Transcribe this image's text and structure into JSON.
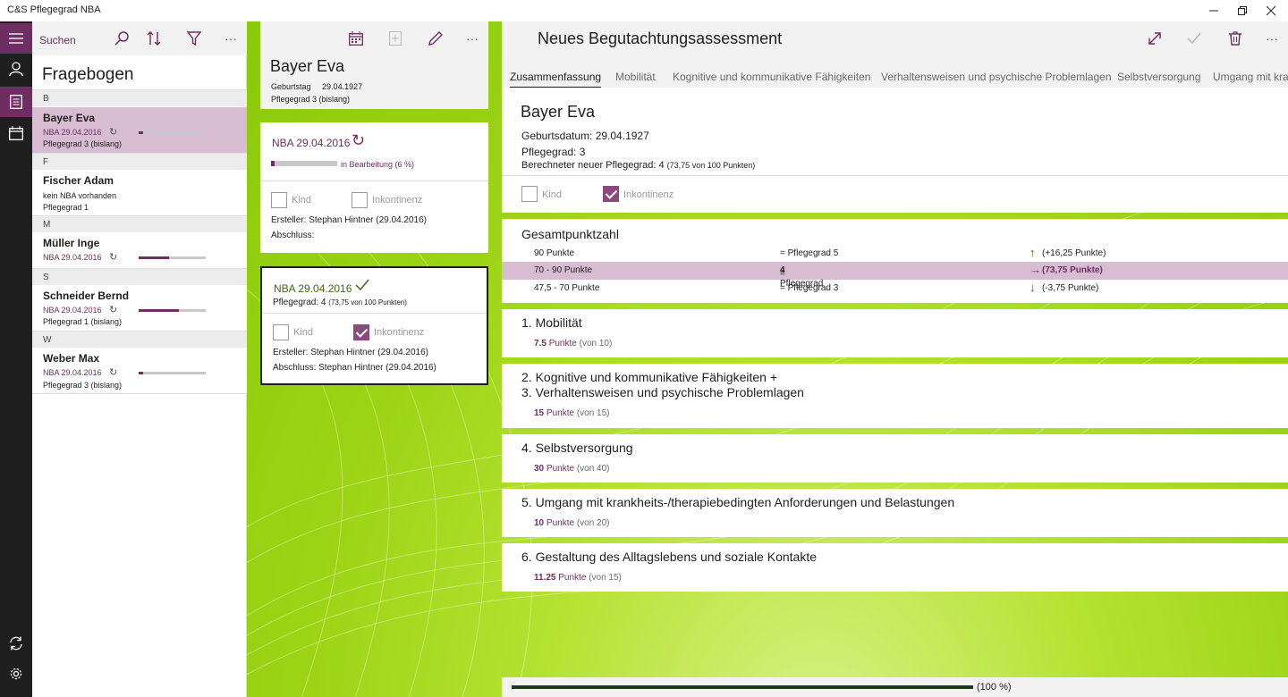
{
  "window": {
    "title": "C&S Pflegegrad NBA"
  },
  "rail": {
    "items": [
      "menu-icon",
      "person-icon",
      "document-icon",
      "calendar-icon",
      "sync-icon",
      "gear-icon"
    ]
  },
  "list": {
    "search_label": "Suchen",
    "heading": "Fragebogen",
    "groups": [
      {
        "letter": "B"
      },
      {
        "letter": "F"
      },
      {
        "letter": "M"
      },
      {
        "letter": "S"
      },
      {
        "letter": "W"
      }
    ],
    "items": [
      {
        "name": "Bayer Eva",
        "nba": "NBA  29.04.2016",
        "sub": "Pflegegrad 3 (bislang)",
        "progress": 0.06,
        "selected": true
      },
      {
        "name": "Fischer Adam",
        "nba_none": "kein NBA vorhanden",
        "sub": "Pflegegrad 1"
      },
      {
        "name": "Müller Inge",
        "nba": "NBA  29.04.2016",
        "progress": 0.45
      },
      {
        "name": "Schneider Bernd",
        "nba": "NBA  29.04.2016",
        "sub": "Pflegegrad 1 (bislang)",
        "progress": 0.6
      },
      {
        "name": "Weber Max",
        "nba": "NBA  29.04.2016",
        "sub": "Pflegegrad 3 (bislang)",
        "progress": 0.06
      }
    ]
  },
  "patient": {
    "name": "Bayer Eva",
    "birthday_label": "Geburtstag",
    "birthday": "29.04.1927",
    "pflegegrad": "Pflegegrad 3 (bislang)"
  },
  "card1": {
    "title": "NBA  29.04.2016",
    "status": "in Bearbeitung  (6 %)",
    "progress": 0.06,
    "kind_label": "Kind",
    "kind_checked": false,
    "inkontinenz_label": "Inkontinenz",
    "inkontinenz_checked": false,
    "ersteller": "Ersteller: Stephan Hintner (29.04.2016)",
    "abschluss": "Abschluss:"
  },
  "card2": {
    "title": "NBA  29.04.2016",
    "pg_prefix": "Pflegegrad: 4",
    "pg_detail": "(73,75 von 100 Punkten)",
    "kind_label": "Kind",
    "kind_checked": false,
    "inkontinenz_label": "Inkontinenz",
    "inkontinenz_checked": true,
    "ersteller": "Ersteller: Stephan Hintner (29.04.2016)",
    "abschluss": "Abschluss: Stephan Hintner (29.04.2016)"
  },
  "right": {
    "title": "Neues Begutachtungsassessment",
    "tabs": [
      "Zusammenfassung",
      "Mobilität",
      "Kognitive und kommunikative Fähigkeiten",
      "Verhaltensweisen und psychische Problemlagen",
      "Selbstversorgung",
      "Umgang mit kra"
    ],
    "summary": {
      "name": "Bayer Eva",
      "geburtsdatum": "Geburtsdatum: 29.04.1927",
      "pflegegrad": "Pflegegrad: 3",
      "berechnet_prefix": "Berechneter neuer Pflegegrad: 4",
      "berechnet_detail": "(73,75 von 100 Punkten)",
      "kind_label": "Kind",
      "inkontinenz_label": "Inkontinenz",
      "inkontinenz_checked": true
    },
    "gesamt": {
      "heading": "Gesamtpunktzahl",
      "rows": [
        {
          "range": "90 Punkte",
          "grade": "= Pflegegrad 5",
          "arrow": "↑",
          "diff": "(+16,25 Punkte)"
        },
        {
          "range": "70 - 90 Punkte",
          "grade_prefix": "= Pflegegrad ",
          "grade_num": "4",
          "arrow": "→",
          "diff": "(73,75 Punkte)",
          "highlight": true
        },
        {
          "range": "47,5 - 70 Punkte",
          "grade": "= Pflegegrad 3",
          "arrow": "↓",
          "diff": "(-3,75 Punkte)"
        }
      ]
    },
    "sections": [
      {
        "h1": "1. Mobilität",
        "value": "7.5",
        "unit": "Punkte",
        "of": "(von 10)"
      },
      {
        "h1": "2. Kognitive und kommunikative Fähigkeiten +",
        "h2": "3. Verhaltensweisen und psychische Problemlagen",
        "value": "15",
        "unit": "Punkte",
        "of": "(von 15)"
      },
      {
        "h1": "4. Selbstversorgung",
        "value": "30",
        "unit": "Punkte",
        "of": "(von 40)"
      },
      {
        "h1": "5. Umgang mit krankheits-/therapiebedingten Anforderungen und Belastungen",
        "value": "10",
        "unit": "Punkte",
        "of": "(von 20)"
      },
      {
        "h1": "6. Gestaltung des Alltagslebens und soziale Kontakte",
        "value": "11.25",
        "unit": "Punkte",
        "of": "(von 15)"
      }
    ],
    "progress_label": "(100 %)",
    "progress": 1.0
  },
  "colors": {
    "accent": "#6e2e63",
    "selected": "#d8bcd2",
    "green": "#9bd414",
    "rail": "#1f1f1f"
  }
}
